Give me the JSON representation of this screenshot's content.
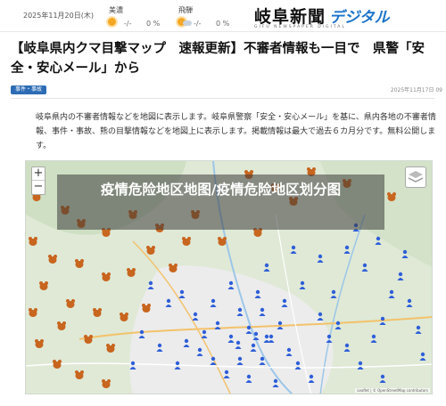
{
  "header": {
    "date": "2025年11月20日(木)",
    "weather": [
      {
        "city": "美濃",
        "temp": "-/-",
        "pct": "0 %"
      },
      {
        "city": "飛騨",
        "temp": "-/-",
        "pct": "0 %"
      }
    ],
    "logo_main": "岐阜新聞",
    "logo_digital": "デジタル",
    "logo_sub": "GIFU NEWSPAPER DIGITAL"
  },
  "article": {
    "headline": "【岐阜県内クマ目撃マップ　速報更新】不審者情報も一目で　県警「安全・安心メール」から",
    "tag": "事件・事故",
    "pubdate": "2025年11月17日 09",
    "body": "岐阜県内の不審者情報などを地図に表示します。岐阜県警察「安全・安心メール」を基に、県内各地の不審者情報、事件・事故、熊の目撃情報などを地図上に表示します。掲載情報は最大で過去６カ月分です。無料公開します。"
  },
  "map": {
    "zoom_in": "+",
    "zoom_out": "−",
    "overlay_title": "疫情危险地区地图/疫情危险地区划分图",
    "attribution": "Leaflet | © OpenStreetMap contributors",
    "bear_color": "#c8651e",
    "person_color": "#2f5fd8"
  }
}
